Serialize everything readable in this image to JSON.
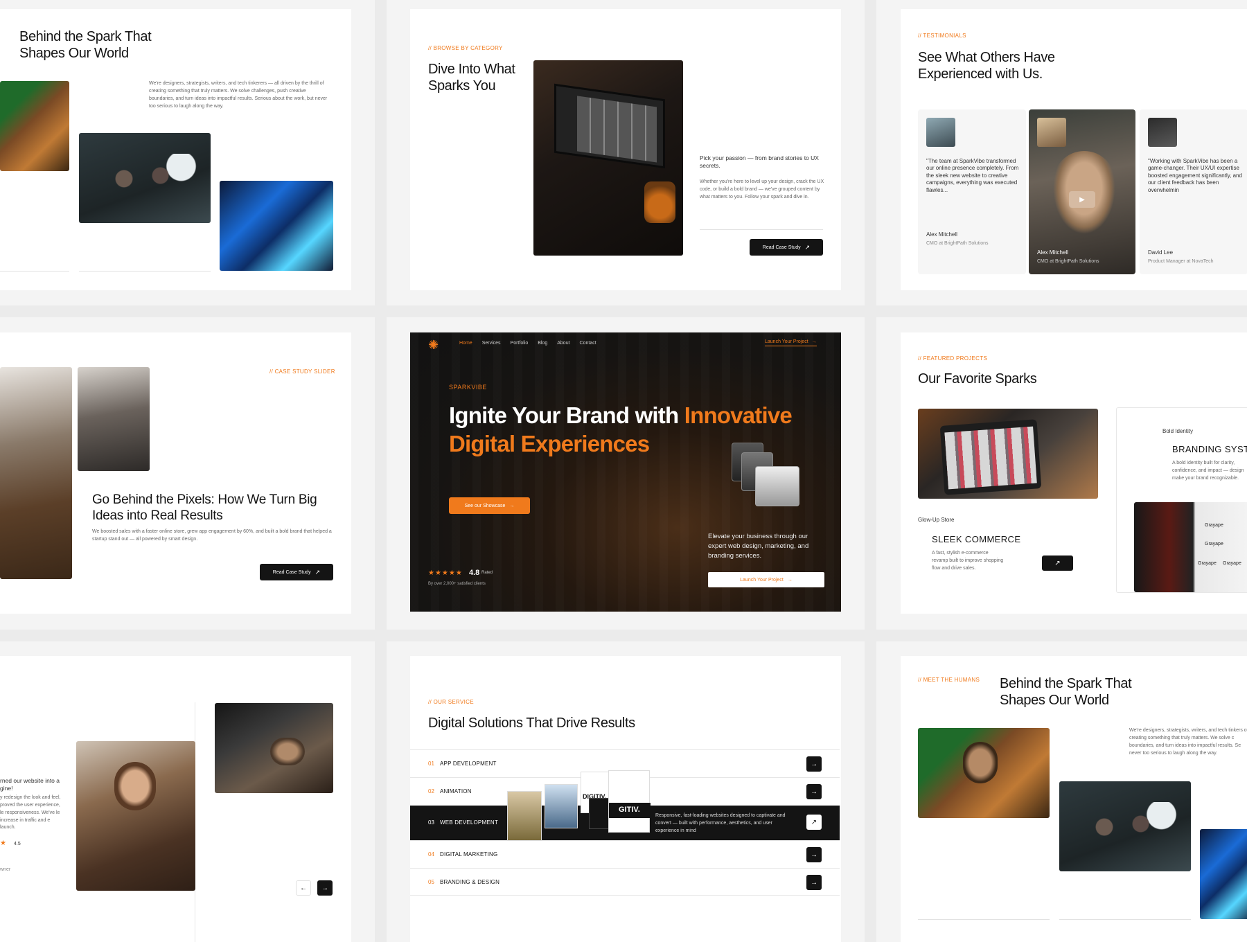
{
  "colors": {
    "accent": "#f07a1c",
    "dark": "#141414",
    "tile_bg": "#f4f4f4"
  },
  "t1": {
    "title": "Behind the Spark That Shapes Our World",
    "body": "We're designers, strategists, writers, and tech tinkerers — all driven by the thrill of creating something that truly matters. We solve challenges, push creative boundaries, and turn ideas into impactful results. Serious about the work, but never too serious to laugh along the way."
  },
  "t2": {
    "eyebrow": "// BROWSE BY CATEGORY",
    "title": "Dive Into What Sparks You",
    "lead": "Pick your passion — from brand stories to UX secrets.",
    "body": "Whether you're here to level up your design, crack the UX code, or build a bold brand — we've grouped content by what matters to you. Follow your spark and dive in.",
    "button": "Read Case Study"
  },
  "t3": {
    "eyebrow": "// TESTIMONIALS",
    "title": "See What Others Have Experienced with Us.",
    "cards": [
      {
        "quote": "\"The team at SparkVibe transformed our online presence completely. From the sleek new website to creative campaigns, everything was executed flawles...",
        "name": "Alex Mitchell",
        "role": "CMO at BrightPath Solutions"
      },
      {
        "quote": "",
        "name": "Alex Mitchell",
        "role": "CMO at BrightPath Solutions"
      },
      {
        "quote": "\"Working with SparkVibe has been a game-changer. Their UX/UI expertise boosted engagement significantly, and our client feedback has been overwhelmin",
        "name": "David Lee",
        "role": "Product Manager at NovaTech"
      }
    ]
  },
  "t4": {
    "eyebrow": "// CASE STUDY SLIDER",
    "title": "Go Behind the Pixels: How We Turn Big Ideas into Real Results",
    "body": "We boosted sales with a faster online store, grew app engagement by 60%, and built a bold brand that helped a startup stand out — all powered by smart design.",
    "button": "Read Case Study"
  },
  "t5": {
    "nav": [
      "Home",
      "Services",
      "Portfolio",
      "Blog",
      "About",
      "Contact"
    ],
    "cta": "Launch Your Project",
    "eyebrow": "SPARKVIBE",
    "title_white": "Ignite Your Brand with",
    "title_accent1": "Innovative",
    "title_accent2": "Digital Experiences",
    "showcase": "See our Showcase",
    "rating": "4.8",
    "rated": "Rated",
    "clients": "By over 2,000+ satisfied clients",
    "stars": "★★★★★",
    "side_text": "Elevate your business through our expert web design, marketing, and branding services.",
    "side_button": "Launch Your Project"
  },
  "t6": {
    "eyebrow": "// FEATURED PROJECTS",
    "title": "Our Favorite Sparks",
    "c1_label": "Glow-Up Store",
    "c1_title": "SLEEK COMMERCE",
    "c1_body": "A fast, stylish e-commerce revamp built to improve shopping flow and drive sales.",
    "c2_label": "Bold Identity",
    "c2_title": "BRANDING SYST",
    "c2_body": "A bold identity built for clarity, confidence, and impact — design make your brand recognizable.",
    "brand": "Grayape"
  },
  "t7": {
    "quote": "rned our website into a gine!",
    "body": "y redesign the look and feel, proved the user experience, le responsiveness. We've le increase in traffic and e launch.",
    "rating": "4.5",
    "owner": "wner"
  },
  "t8": {
    "eyebrow": "// OUR SERVICE",
    "title": "Digital Solutions That Drive Results",
    "items": [
      {
        "num": "01",
        "label": "APP DEVELOPMENT"
      },
      {
        "num": "02",
        "label": "ANIMATION"
      },
      {
        "num": "03",
        "label": "WEB DEVELOPMENT"
      },
      {
        "num": "04",
        "label": "DIGITAL MARKETING"
      },
      {
        "num": "05",
        "label": "BRANDING & DESIGN"
      }
    ],
    "active_desc": "Responsive, fast-loading websites designed to captivate and convert — built with performance, aesthetics, and user experience in mind",
    "mock1": "DIGITIV.",
    "mock2": "GITIV."
  },
  "t9": {
    "eyebrow": "// MEET THE HUMANS",
    "title": "Behind the Spark That Shapes Our World",
    "body": "We're designers, strategists, writers, and tech tinkers of creating something that truly matters. We solve c boundaries, and turn ideas into impactful results. Se never too serious to laugh along the way."
  }
}
